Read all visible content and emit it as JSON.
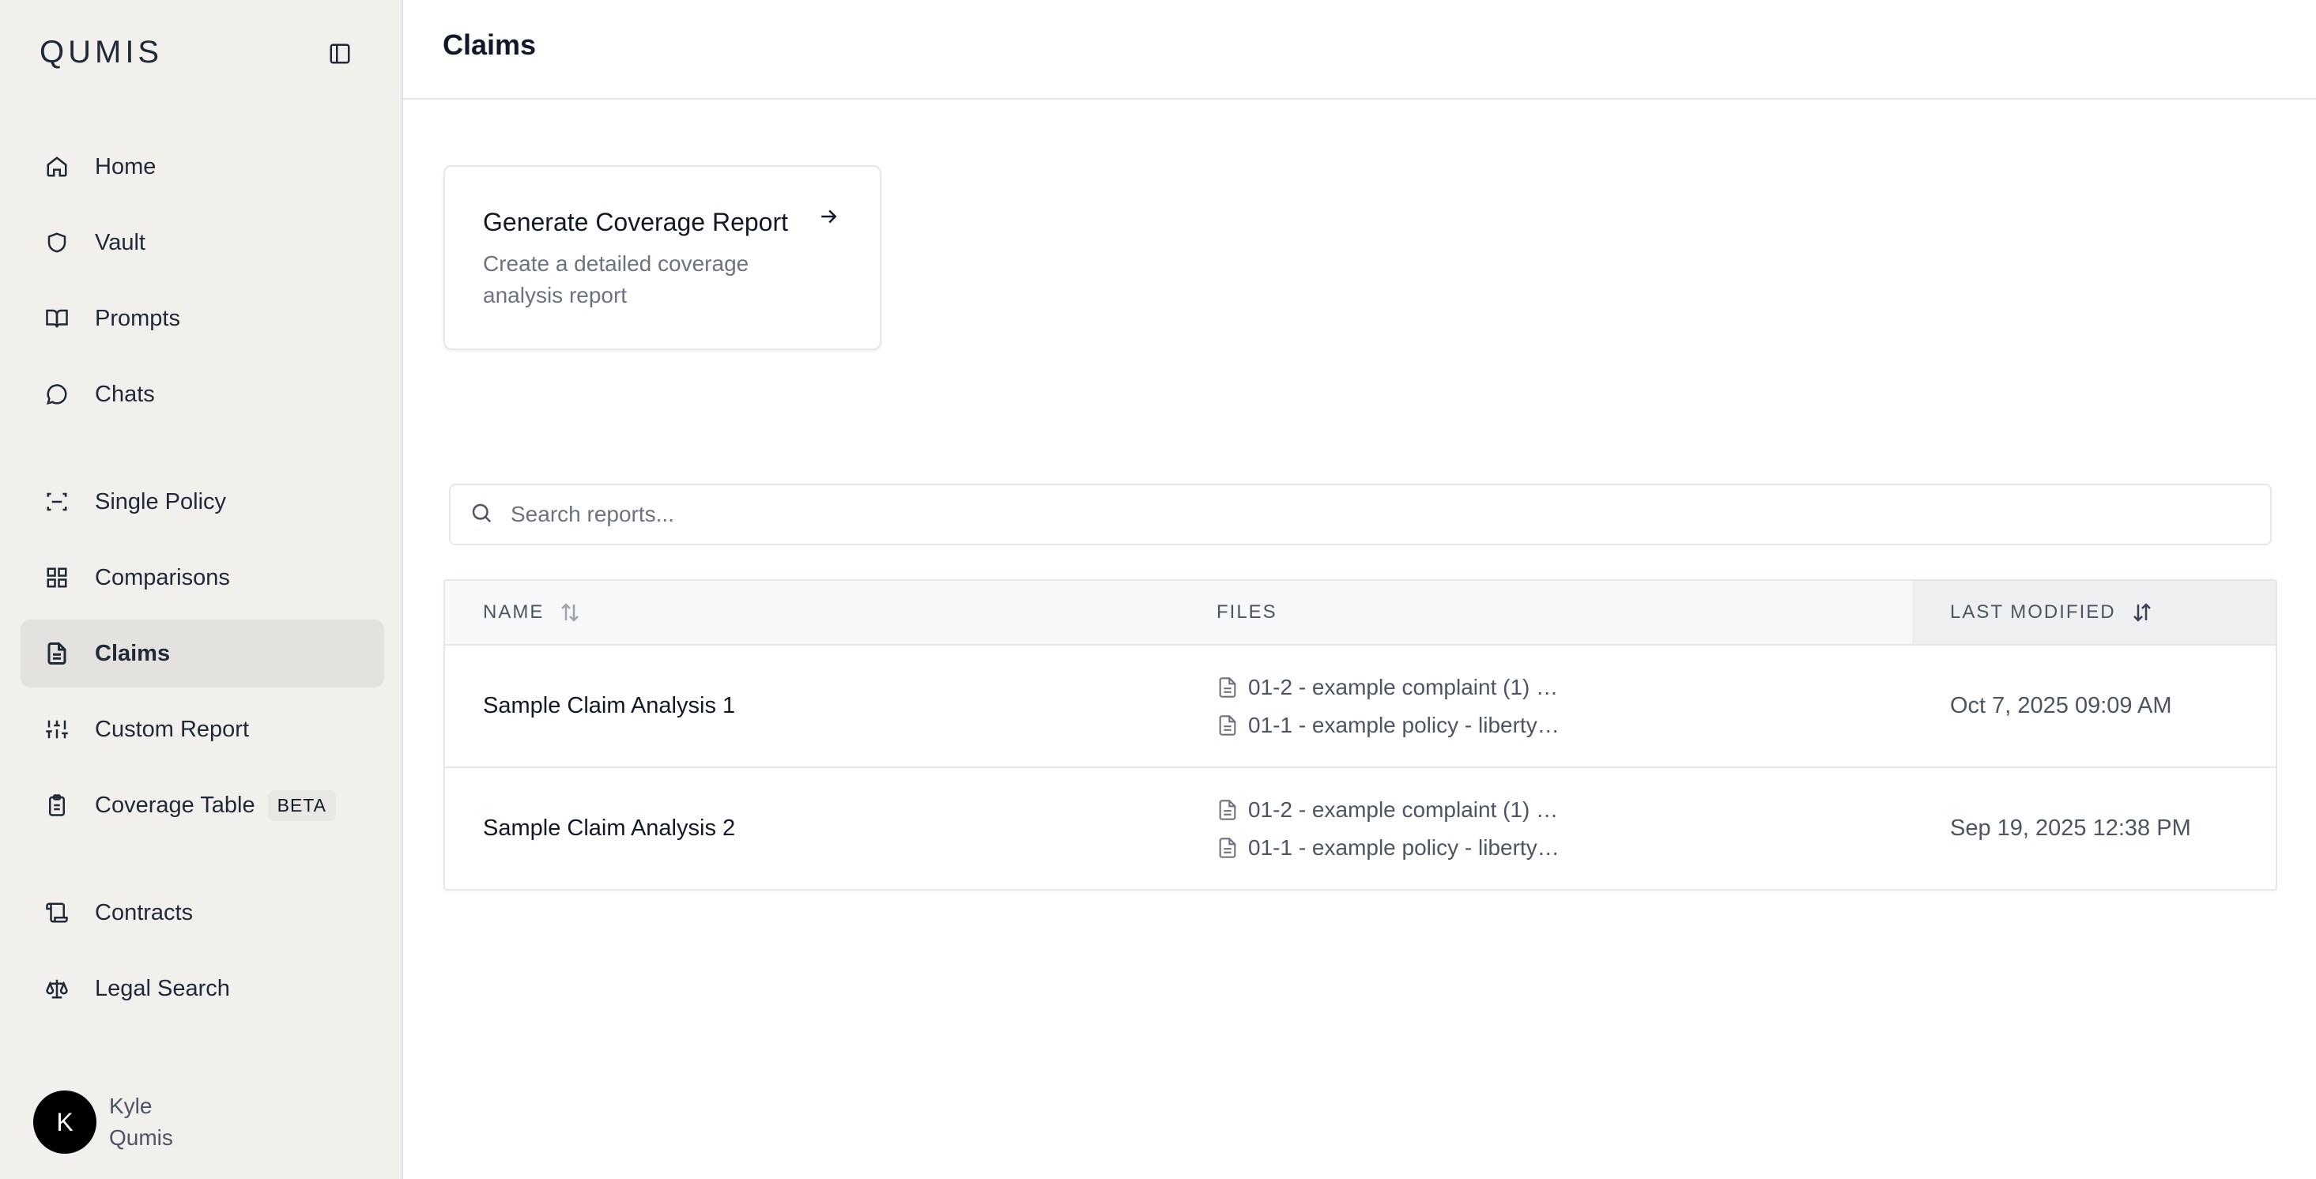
{
  "sidebar": {
    "brand": "QUMIS",
    "items": [
      {
        "label": "Home",
        "icon": "home-icon"
      },
      {
        "label": "Vault",
        "icon": "shield-icon"
      },
      {
        "label": "Prompts",
        "icon": "book-icon"
      },
      {
        "label": "Chats",
        "icon": "chat-bubble-icon"
      },
      {
        "label": "Single Policy",
        "icon": "scan-icon"
      },
      {
        "label": "Comparisons",
        "icon": "grid-icon"
      },
      {
        "label": "Claims",
        "icon": "document-icon",
        "active": true
      },
      {
        "label": "Custom Report",
        "icon": "sliders-icon"
      },
      {
        "label": "Coverage Table",
        "icon": "clipboard-icon",
        "badge": "BETA"
      },
      {
        "label": "Contracts",
        "icon": "scroll-icon"
      },
      {
        "label": "Legal Search",
        "icon": "scale-icon"
      }
    ],
    "user": {
      "initial": "K",
      "first_name": "Kyle",
      "last_name": "Qumis"
    }
  },
  "header": {
    "title": "Claims"
  },
  "card": {
    "title": "Generate Coverage Report",
    "description": "Create a detailed coverage analysis report",
    "icon": "arrow-right-icon"
  },
  "search": {
    "placeholder": "Search reports...",
    "value": ""
  },
  "table": {
    "columns": [
      "NAME",
      "FILES",
      "LAST MODIFIED"
    ],
    "rows": [
      {
        "name": "Sample Claim Analysis 1",
        "files": [
          "01-2 - example complaint (1) …",
          "01-1 - example policy - liberty…"
        ],
        "modified": "Oct 7, 2025 09:09 AM"
      },
      {
        "name": "Sample Claim Analysis 2",
        "files": [
          "01-2 - example complaint (1) …",
          "01-1 - example policy - liberty…"
        ],
        "modified": "Sep 19, 2025 12:38 PM"
      }
    ]
  },
  "colors": {
    "sidebar_bg": "#f1f0ec",
    "active_item_bg": "#e3e2df",
    "avatar_bg": "#000000"
  }
}
